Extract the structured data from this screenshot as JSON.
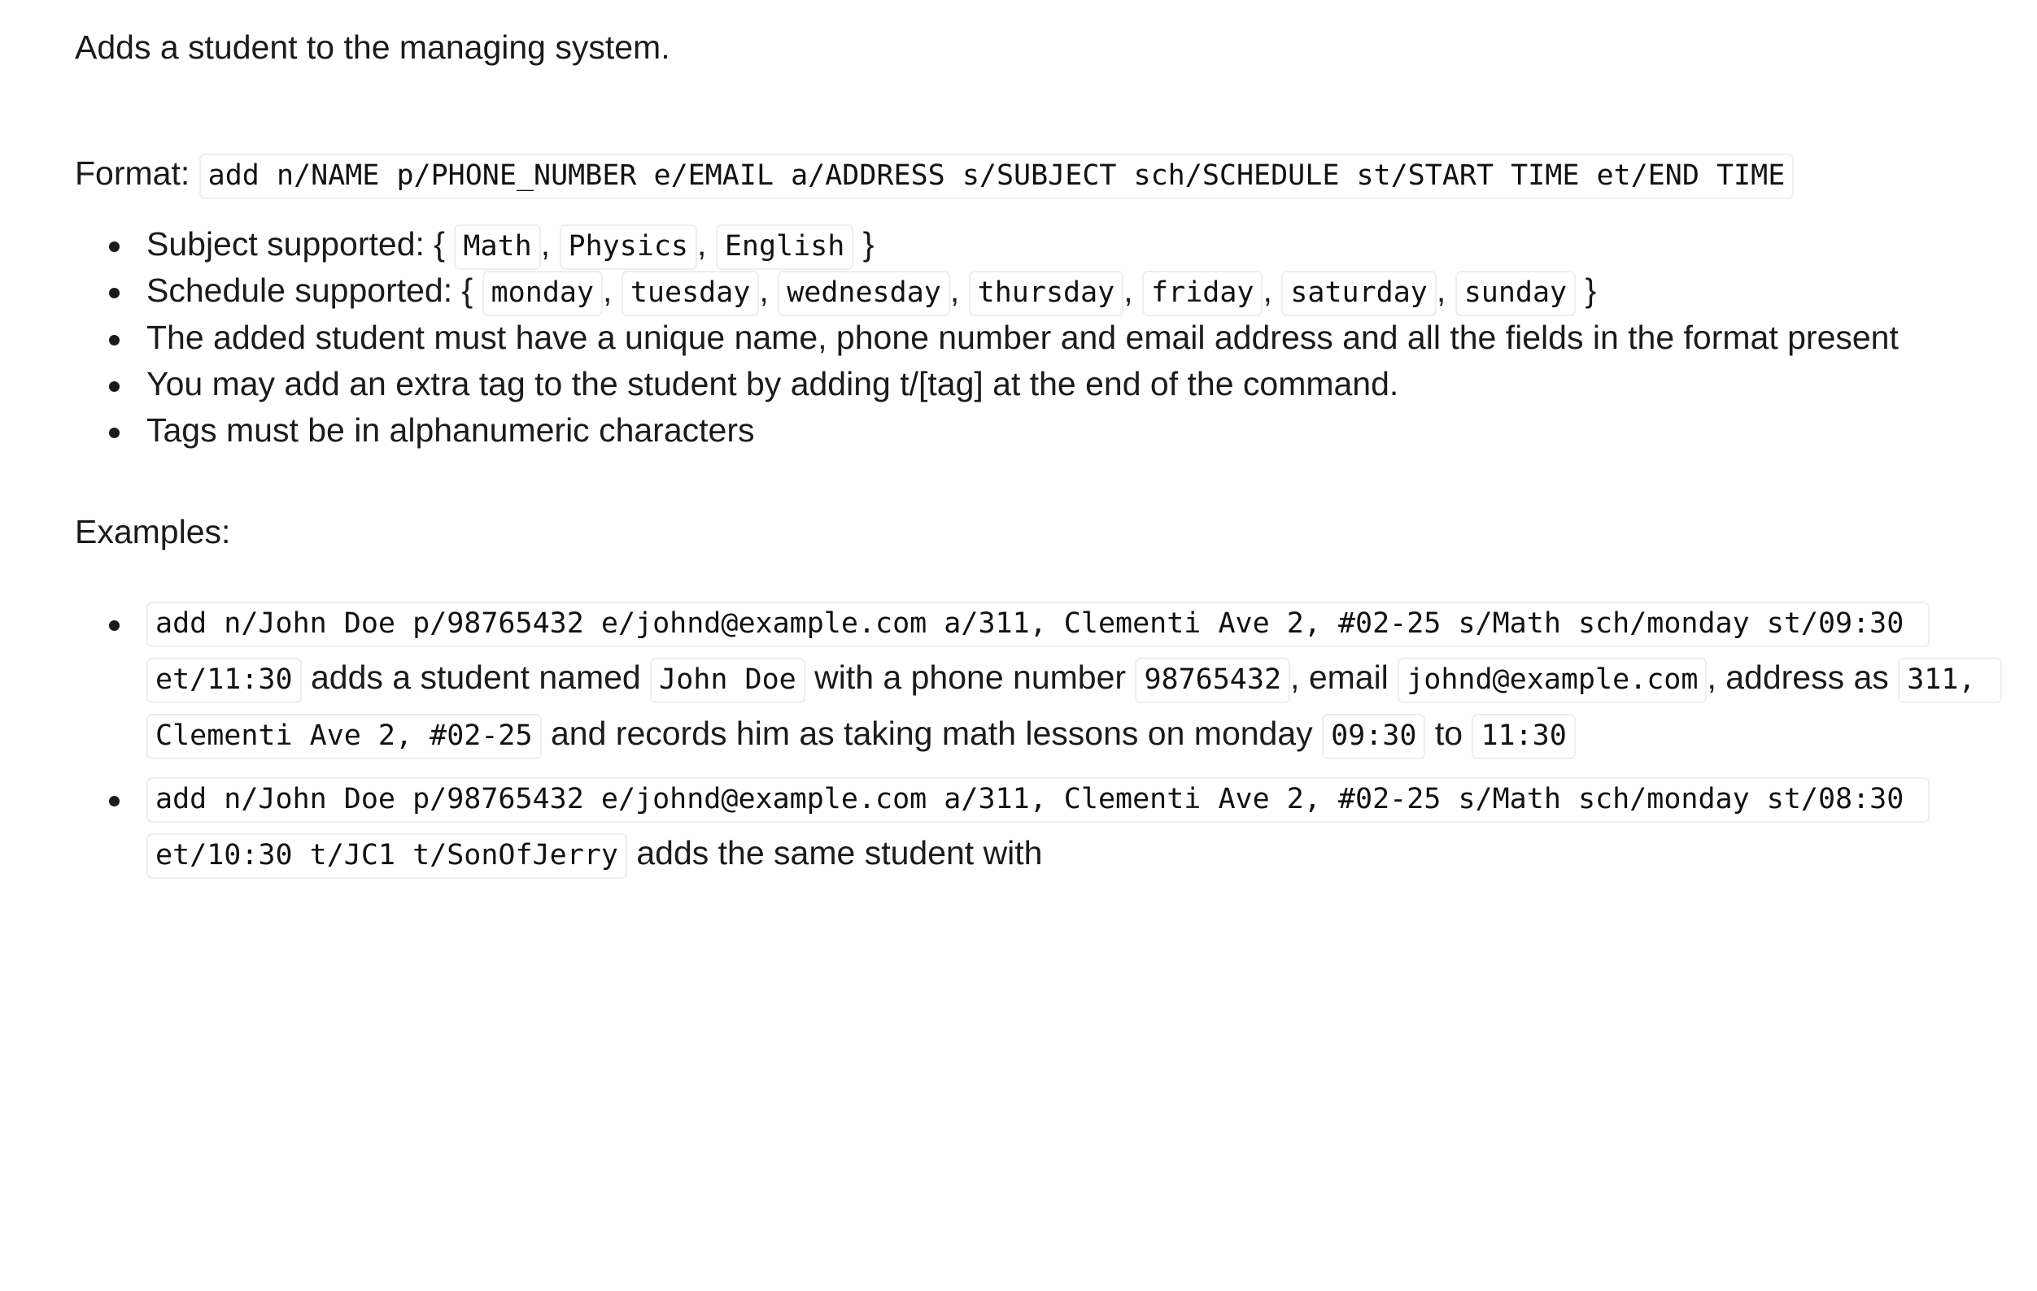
{
  "page": {
    "description": "Adds a student to the managing system.",
    "format_label": "Format:",
    "format_command": "add n/NAME p/PHONE_NUMBER e/EMAIL a/ADDRESS s/SUBJECT sch/SCHEDULE st/START TIME et/END TIME",
    "examples_label": "Examples:"
  },
  "notes": {
    "subject_label": "Subject supported: {",
    "subject_values": [
      "Math",
      "Physics",
      "English"
    ],
    "subject_close": "}",
    "schedule_label": "Schedule supported: {",
    "schedule_values": [
      "monday",
      "tuesday",
      "wednesday",
      "thursday",
      "friday",
      "saturday",
      "sunday"
    ],
    "schedule_close": "}",
    "comma": ",",
    "bullet_unique": "The added student must have a unique name, phone number and email address and all the fields in the format present",
    "bullet_tag": "You may add an extra tag to the student by adding t/[tag] at the end of the command.",
    "bullet_alphanumeric": "Tags must be in alphanumeric characters"
  },
  "examples": [
    {
      "command": "add n/John Doe p/98765432 e/johnd@example.com a/311, Clementi Ave 2, #02-25 s/Math sch/monday st/09:30 et/11:30",
      "t1": "adds a student named",
      "name": "John Doe",
      "t2": "with a phone number",
      "phone": "98765432",
      "t3": ", email",
      "email": "johnd@example.com",
      "t4": ", address as",
      "address": "311, Clementi Ave 2, #02-25",
      "t5": "and records him as taking math lessons on monday",
      "start_time": "09:30",
      "t6": "to",
      "end_time": "11:30"
    },
    {
      "command": "add n/John Doe p/98765432 e/johnd@example.com a/311, Clementi Ave 2, #02-25 s/Math sch/monday st/08:30 et/10:30 t/JC1 t/SonOfJerry",
      "t1": "adds the same student with"
    }
  ],
  "colors": {
    "text": "#1b1b1b",
    "code_border": "#eceef0",
    "code_bg": "#ffffff",
    "page_bg": "#ffffff"
  }
}
